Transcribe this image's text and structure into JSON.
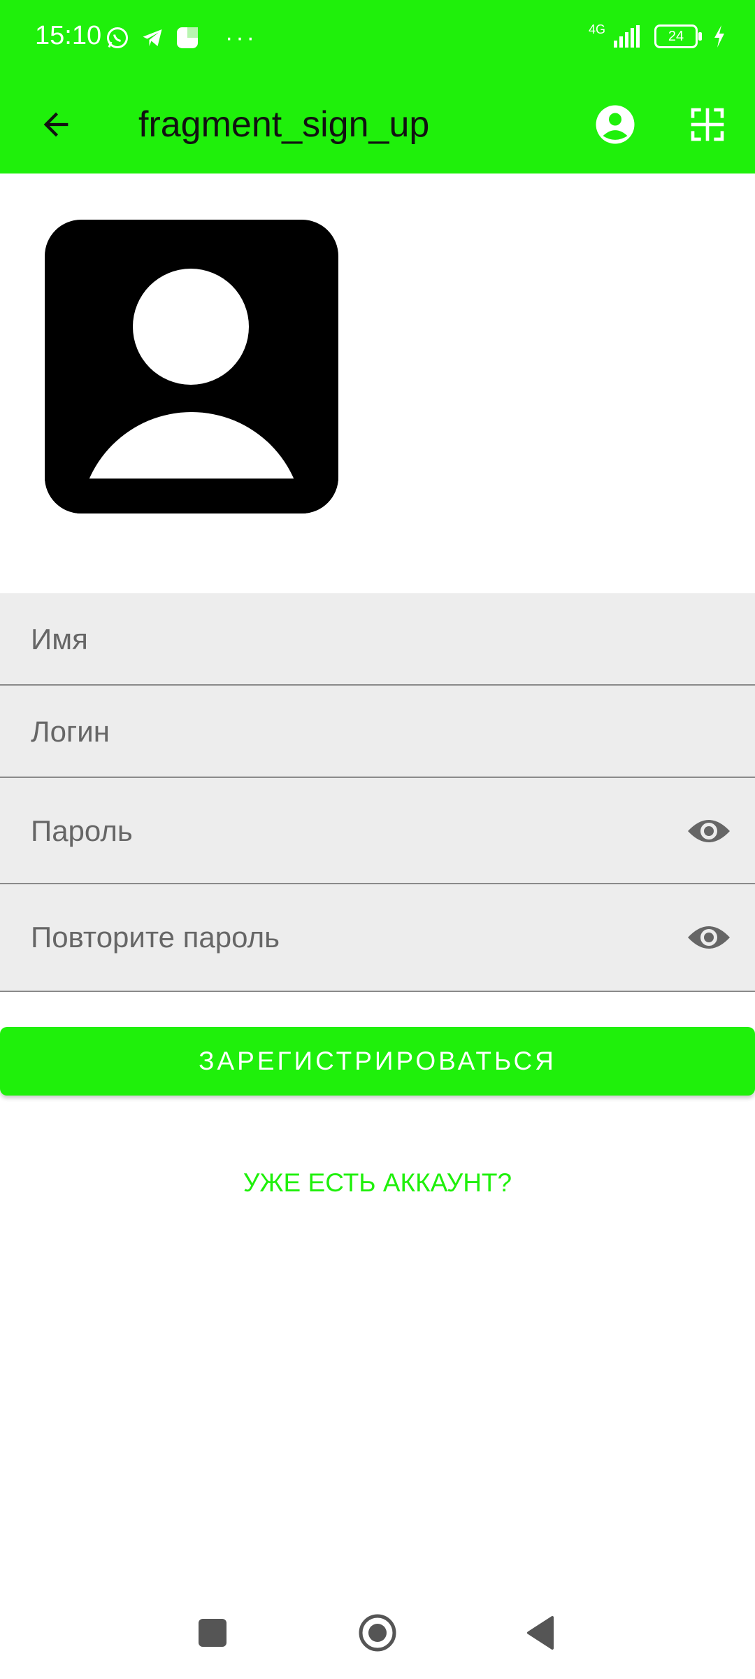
{
  "status_bar": {
    "time": "15:10",
    "network": "4G",
    "battery": "24",
    "left_icons": [
      "whatsapp-icon",
      "telegram-icon",
      "app-icon",
      "more-dots-icon"
    ],
    "right_icons": [
      "signal-icon",
      "battery-icon",
      "charging-icon"
    ]
  },
  "app_bar": {
    "title": "fragment_sign_up",
    "back_icon": "arrow-back-icon",
    "account_icon": "account-circle-icon",
    "qr_icon": "qr-scan-icon",
    "color": "#1ff00b"
  },
  "avatar": {
    "icon": "person-placeholder-icon"
  },
  "form": {
    "name_placeholder": "Имя",
    "login_placeholder": "Логин",
    "password_placeholder": "Пароль",
    "repeat_password_placeholder": "Повторите пароль",
    "password_toggle_icon": "eye-icon"
  },
  "actions": {
    "register_label": "ЗАРЕГИСТРИРОВАТЬСЯ",
    "have_account_label": "УЖЕ ЕСТЬ АККАУНТ?"
  },
  "nav_bar": {
    "recents_icon": "square-recents-icon",
    "home_icon": "home-circle-icon",
    "back_icon": "triangle-back-icon"
  }
}
